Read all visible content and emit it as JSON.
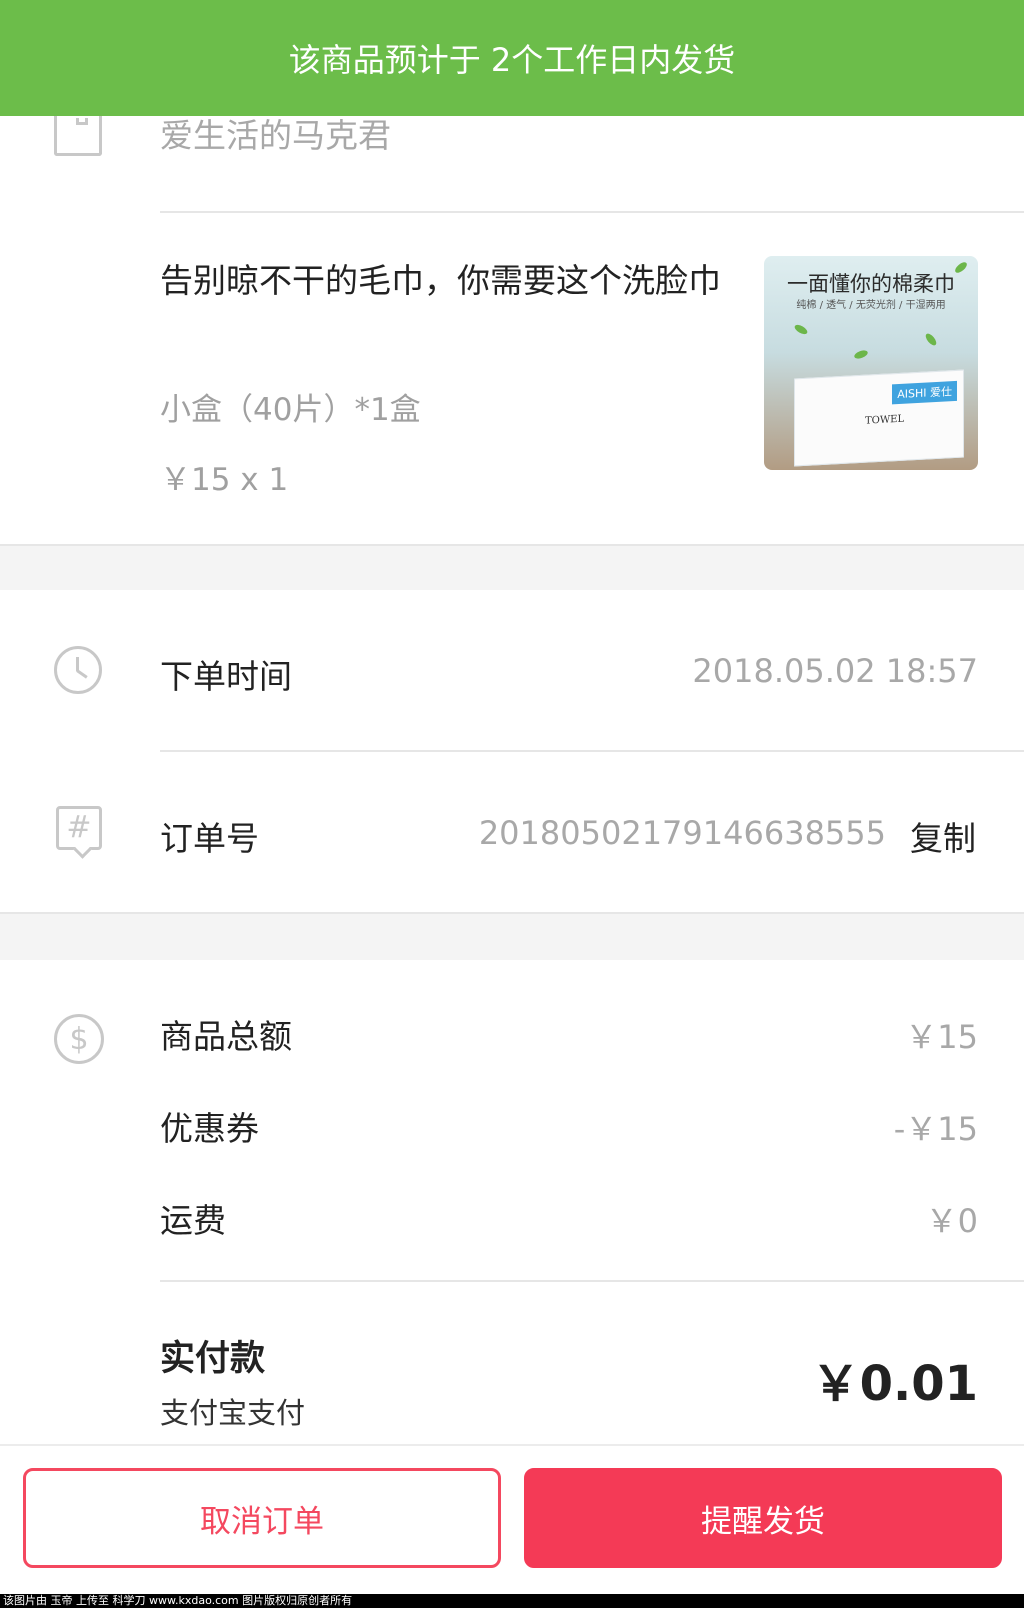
{
  "banner": {
    "text": "该商品预计于 2个工作日内发货"
  },
  "shop": {
    "name": "爱生活的马克君",
    "icon": "shop-icon"
  },
  "product": {
    "title": "告别晾不干的毛巾，你需要这个洗脸巾",
    "spec": "小盒（40片）*1盒",
    "price": "￥15 x 1",
    "thumbnail": {
      "headline": "一面懂你的棉柔巾",
      "subline": "纯棉 / 透气 / 无荧光剂 / 干湿两用",
      "brand": "AISHI 爱仕",
      "towel_text": "TOWEL"
    }
  },
  "order": {
    "time_label": "下单时间",
    "time_value": "2018.05.02 18:57",
    "number_label": "订单号",
    "number_value": "201805021791466385​55",
    "copy_label": "复制"
  },
  "payment": {
    "goods_total_label": "商品总额",
    "goods_total_value": "￥15",
    "coupon_label": "优惠券",
    "coupon_value": "-￥15",
    "shipping_label": "运费",
    "shipping_value": "￥0",
    "paid_label": "实付款",
    "paid_method": "支付宝支付",
    "paid_amount": "￥0.01"
  },
  "actions": {
    "cancel_label": "取消订单",
    "remind_label": "提醒发货"
  },
  "footer": {
    "note": "该图片由 玉帝 上传至 科学刀 www.kxdao.com 图片版权归原创者所有"
  },
  "colors": {
    "banner_bg": "#6cbd4a",
    "accent_red": "#f43a56",
    "muted_text": "#a8a8a8",
    "divider": "#e6e6e6"
  }
}
